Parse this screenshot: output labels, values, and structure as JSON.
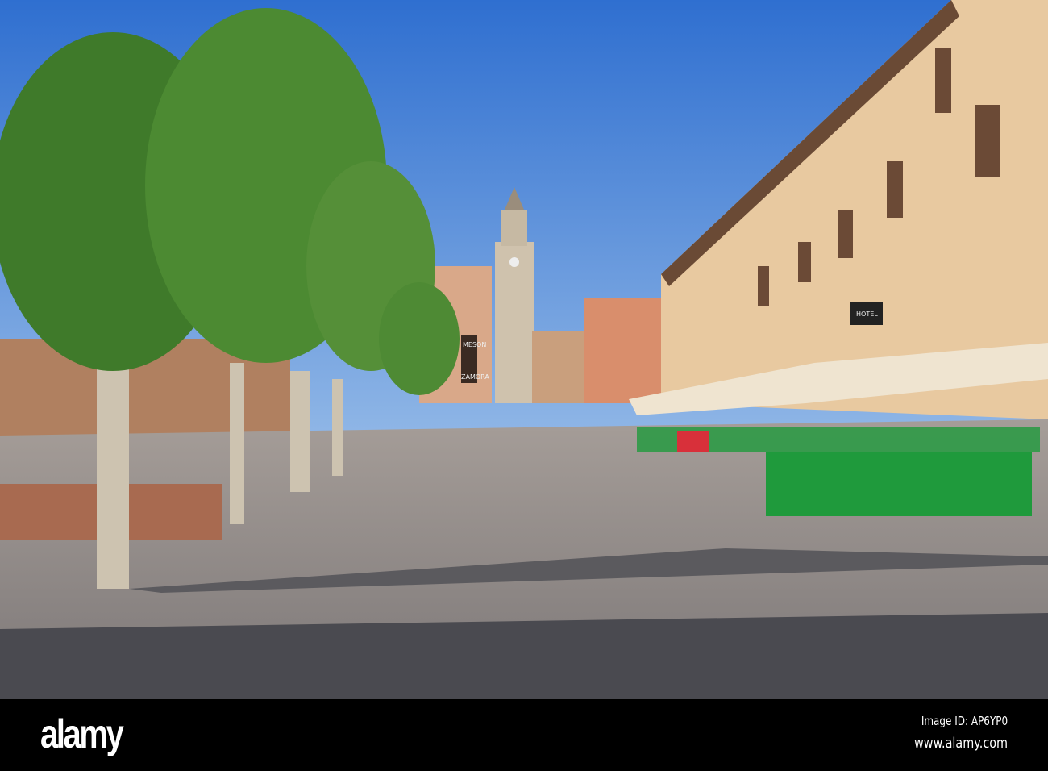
{
  "photo": {
    "signs": {
      "meson": "MESON",
      "zamora": "ZAMORA",
      "hotel": "HOTEL"
    },
    "colors": {
      "sky": "#3f7fd6",
      "pavement": "#8a8585",
      "trees": "#3f7a2a",
      "buildings": "#e8c9a0",
      "chairs": "#1f9a3c"
    }
  },
  "watermark": {
    "logo": "alamy",
    "image_id": "Image ID: AP6YP0",
    "url": "www.alamy.com"
  }
}
